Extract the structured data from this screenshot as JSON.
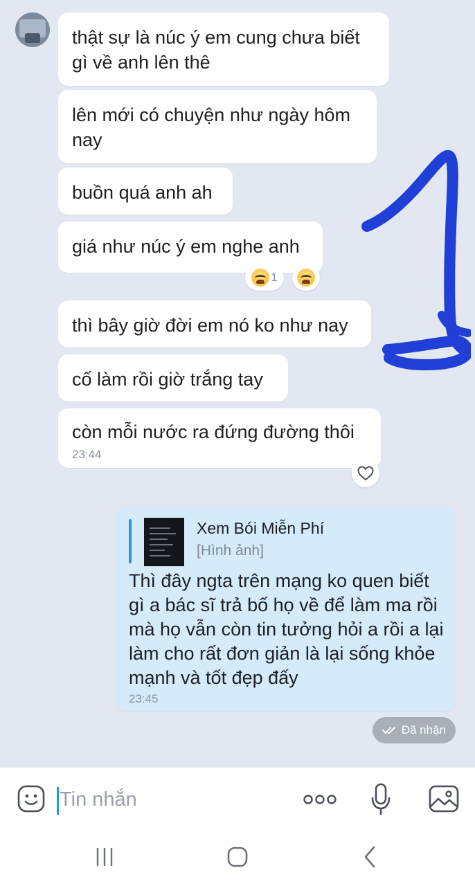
{
  "chat": {
    "received": [
      {
        "text": "thật sự là núc ý em cung chưa biết gì về anh lên thê"
      },
      {
        "text": "lên mới có chuyện như ngày hôm nay"
      },
      {
        "text": "buồn quá anh ah"
      },
      {
        "text": "giá như núc ý em nghe anh",
        "reaction_count": "1",
        "reaction_icon": "crying-face-icon"
      },
      {
        "text": "thì bây giờ đời em nó ko như nay"
      },
      {
        "text": "cố làm rồi giờ trắng tay"
      },
      {
        "text": "còn mỗi nước ra đứng đường thôi",
        "time": "23:44"
      }
    ],
    "sent": {
      "quote": {
        "name": "Xem Bói Miễn Phí",
        "subtitle": "[Hình ảnh]"
      },
      "text": "Thì đây ngta trên mạng ko quen biết gì a bác sĩ trả bố họ về để làm ma rồi mà họ vẫn còn tin tưởng hỏi a rồi a lại làm cho rất đơn giản là lại sống khỏe mạnh và tốt đẹp đấy",
      "time": "23:45"
    },
    "status": "Đã nhận"
  },
  "composer": {
    "placeholder": "Tin nhắn",
    "icons": [
      "emoji-icon",
      "more-icon",
      "microphone-icon",
      "image-icon"
    ]
  },
  "colors": {
    "background": "#e3e7f1",
    "received_bubble": "#ffffff",
    "sent_bubble": "#d5ebfa",
    "accent": "#1f9bd8",
    "scribble": "#1f3fd6"
  }
}
